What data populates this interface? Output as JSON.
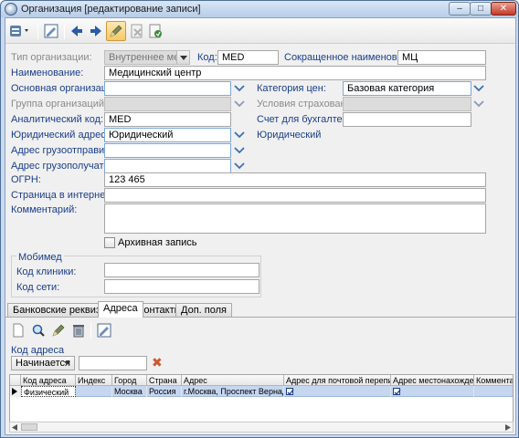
{
  "window": {
    "title": "Организация [редактирование записи]",
    "min_glyph": "–",
    "max_glyph": "□",
    "close_glyph": "✕"
  },
  "toolbar": {
    "icons": [
      "settings-menu-icon",
      "save-form-icon",
      "arrow-left-icon",
      "arrow-right-icon",
      "pencil-edit-icon",
      "cancel-edit-icon",
      "save-close-icon"
    ]
  },
  "form": {
    "org_type_label": "Тип организации:",
    "org_type_value": "Внутреннее мед. уч",
    "code_label": "Код:",
    "code_value": "MED",
    "short_name_label": "Сокращенное наименование:",
    "short_name_value": "МЦ",
    "name_label": "Наименование:",
    "name_value": "Медицинский центр",
    "main_org_label": "Основная организация:",
    "main_org_value": "",
    "price_category_label": "Категория цен:",
    "price_category_value": "Базовая категория",
    "org_group_label": "Группа организаций:",
    "insurance_label": "Условия страхования:",
    "analytic_code_label": "Аналитический код:",
    "analytic_code_value": "MED",
    "accounting_label": "Счет для бухгалтерии:",
    "accounting_value": "",
    "legal_address_label": "Юридический адрес:",
    "legal_address_value": "Юридический",
    "legal_address_side": "Юридический",
    "shipper_address_label": "Адрес грузоотправителя:",
    "consignee_address_label": "Адрес грузополучателя:",
    "ogrn_label": "ОГРН:",
    "ogrn_value": "123 465",
    "website_label": "Страница в интернет:",
    "website_value": "",
    "comment_label": "Комментарий:",
    "comment_value": "",
    "archive_label": "Архивная запись"
  },
  "mobimed": {
    "title": "Мобимед",
    "clinic_code_label": "Код клиники:",
    "network_code_label": "Код сети:"
  },
  "tabs": [
    "Банковские реквизиты",
    "Адреса",
    "Контакты",
    "Доп. поля"
  ],
  "selected_tab": 1,
  "addresses": {
    "toolbar_icons": [
      "new-document-icon",
      "search-icon",
      "pencil-edit-icon",
      "trash-icon",
      "edit-document-icon"
    ],
    "filter_label": "Код адреса",
    "filter_mode": "Начинается",
    "filter_value": "",
    "clear_glyph": "✖",
    "columns": [
      "Код адреса",
      "Индекс",
      "Город",
      "Страна",
      "Адрес",
      "Адрес для почтовой переписки",
      "Адрес местонахождения",
      "Комментарий"
    ],
    "rows": [
      {
        "code": "Физический",
        "index": "",
        "city": "Москва",
        "country": "Россия",
        "address": "г.Москва, Проспект Вернадского",
        "postal": true,
        "location": true,
        "comment": ""
      }
    ]
  },
  "colors": {
    "label_blue": "#1a3e8a",
    "label_gray": "#8a8a8a",
    "selected_row": "#c5d6f0",
    "chevron": "#3b6fb5",
    "clear_x": "#d0572a"
  }
}
